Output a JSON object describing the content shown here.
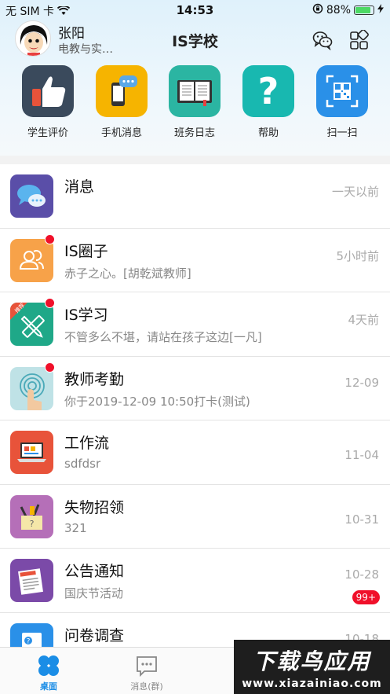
{
  "status": {
    "carrier": "无 SIM 卡",
    "time": "14:53",
    "battery": "88%",
    "battery_level": 0.88
  },
  "header": {
    "user_name": "张阳",
    "user_subtitle": "电教与实…",
    "title": "IS学校"
  },
  "quick": [
    {
      "label": "学生评价",
      "icon": "thumbs-up-icon"
    },
    {
      "label": "手机消息",
      "icon": "phone-message-icon"
    },
    {
      "label": "班务日志",
      "icon": "book-icon"
    },
    {
      "label": "帮助",
      "icon": "help-icon"
    },
    {
      "label": "扫一扫",
      "icon": "qr-scan-icon"
    }
  ],
  "rows": [
    {
      "title": "消息",
      "sub": "",
      "time": "一天以前"
    },
    {
      "title": "IS圈子",
      "sub": "赤子之心。[胡乾斌教师]",
      "time": "5小时前"
    },
    {
      "title": "IS学习",
      "sub": "不管多么不堪，请站在孩子这边[一凡]",
      "time": "4天前",
      "tag": "推荐"
    },
    {
      "title": "教师考勤",
      "sub": "你于2019-12-09 10:50打卡(测试)",
      "time": "12-09"
    },
    {
      "title": "工作流",
      "sub": "sdfdsr",
      "time": "11-04"
    },
    {
      "title": "失物招领",
      "sub": "321",
      "time": "10-31"
    },
    {
      "title": "公告通知",
      "sub": "国庆节活动",
      "time": "10-28",
      "badge": "99+"
    },
    {
      "title": "问卷调查",
      "sub": "",
      "time": "10-18"
    }
  ],
  "tabs": {
    "desk": "桌面",
    "messages": "消息(群)"
  },
  "watermark": {
    "line1": "下载鸟应用",
    "line2": "www.xiazainiao.com"
  }
}
